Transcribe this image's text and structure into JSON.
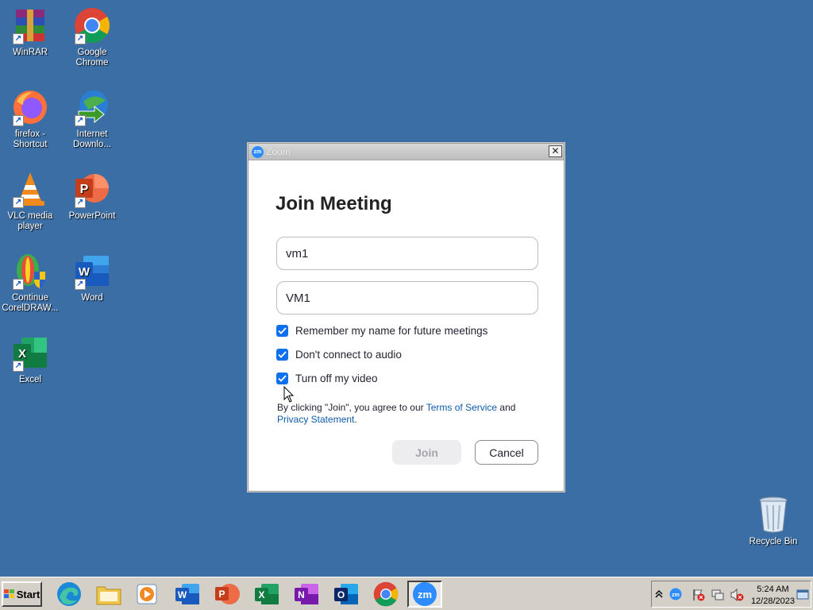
{
  "desktop": {
    "icons": [
      {
        "label": "WinRAR"
      },
      {
        "label": "Google Chrome"
      },
      {
        "label": "firefox - Shortcut"
      },
      {
        "label": "Internet Downlo..."
      },
      {
        "label": "VLC media player"
      },
      {
        "label": "PowerPoint"
      },
      {
        "label": "Continue CorelDRAW..."
      },
      {
        "label": "Word"
      },
      {
        "label": "Excel"
      },
      {
        "label": "Recycle Bin"
      }
    ]
  },
  "zoom_dialog": {
    "window_title": "Zoom",
    "close_glyph": "✕",
    "heading": "Join Meeting",
    "meeting_id_value": "vm1",
    "name_value": "VM1",
    "options": [
      {
        "label": "Remember my name for future meetings",
        "checked": true
      },
      {
        "label": "Don't connect to audio",
        "checked": true
      },
      {
        "label": "Turn off my video",
        "checked": true
      }
    ],
    "terms_prefix": "By clicking \"Join\", you agree to our ",
    "terms_link": "Terms of Service",
    "terms_and": " and ",
    "privacy_link": "Privacy Statement",
    "terms_suffix": ".",
    "join_label": "Join",
    "cancel_label": "Cancel"
  },
  "taskbar": {
    "start_label": "Start",
    "apps": [
      "edge-icon",
      "file-explorer-icon",
      "media-player-icon",
      "word-icon",
      "powerpoint-icon",
      "excel-icon",
      "onenote-icon",
      "outlook-icon",
      "chrome-icon",
      "zoom-icon"
    ],
    "active_app": "zoom-icon",
    "clock_time": "5:24 AM",
    "clock_date": "12/28/2023"
  },
  "colors": {
    "desktop_bg": "#3a6ea5",
    "zoom_blue": "#0e71eb",
    "link_blue": "#0e5baa"
  }
}
